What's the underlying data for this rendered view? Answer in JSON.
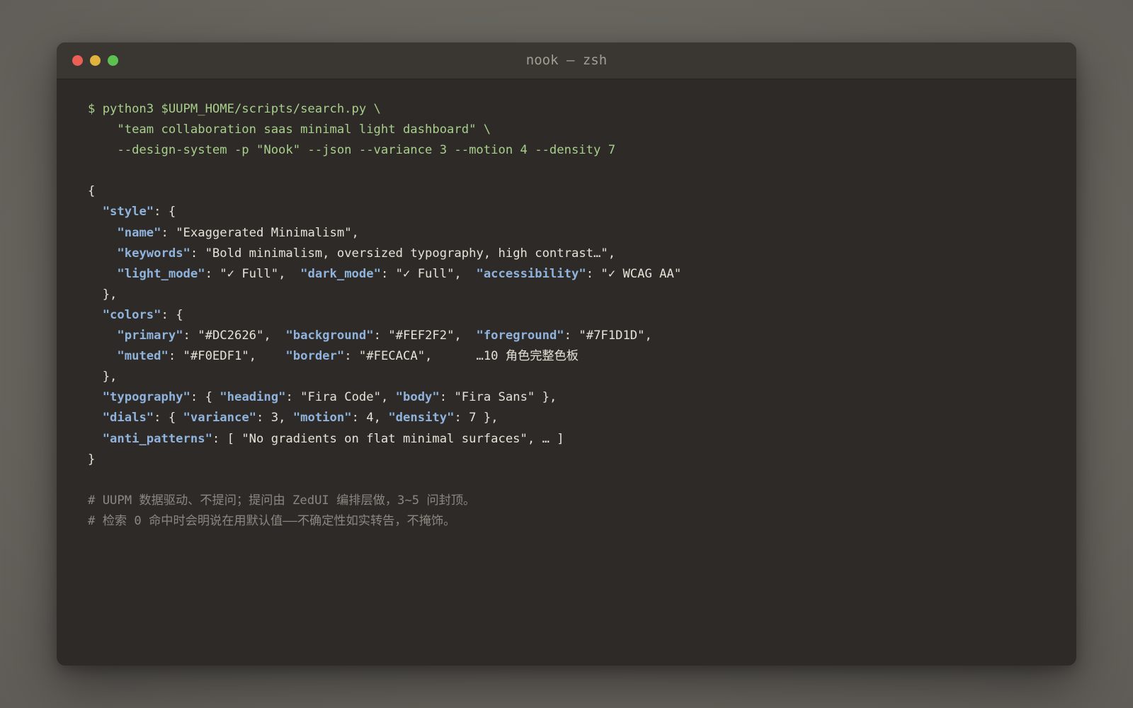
{
  "window": {
    "title": "nook — zsh",
    "accent_colors": {
      "close": "#ec5f57",
      "minimize": "#e0b23e",
      "zoom": "#5cc150",
      "command": "#a8cf8b",
      "json_key": "#8fb3dc",
      "comment": "#8c8780"
    }
  },
  "terminal": {
    "command": {
      "line1": "$ python3 $UUPM_HOME/scripts/search.py \\",
      "line2": "    \"team collaboration saas minimal light dashboard\" \\",
      "line3": "    --design-system -p \"Nook\" --json --variance 3 --motion 4 --density 7"
    },
    "json": {
      "open_brace": "{",
      "close_brace": "}",
      "style": {
        "open": "  ",
        "key": "\"style\"",
        "after": ": {",
        "name": {
          "indent": "    ",
          "key": "\"name\"",
          "rest": ": \"Exaggerated Minimalism\","
        },
        "keywords": {
          "indent": "    ",
          "key": "\"keywords\"",
          "rest": ": \"Bold minimalism, oversized typography, high contrast…\","
        },
        "modes": {
          "indent": "    ",
          "light_key": "\"light_mode\"",
          "light_val": ": \"✓ Full\",  ",
          "dark_key": "\"dark_mode\"",
          "dark_val": ": \"✓ Full\",  ",
          "access_key": "\"accessibility\"",
          "access_val": ": \"✓ WCAG AA\""
        },
        "close": "  },"
      },
      "colors": {
        "open": "  ",
        "key": "\"colors\"",
        "after": ": {",
        "row1": {
          "indent": "    ",
          "primary_key": "\"primary\"",
          "primary_val": ": \"#DC2626\",  ",
          "background_key": "\"background\"",
          "background_val": ": \"#FEF2F2\",  ",
          "foreground_key": "\"foreground\"",
          "foreground_val": ": \"#7F1D1D\","
        },
        "row2": {
          "indent": "    ",
          "muted_key": "\"muted\"",
          "muted_val": ": \"#F0EDF1\",    ",
          "border_key": "\"border\"",
          "border_val": ": \"#FECACA\",      …10 角色完整色板"
        },
        "close": "  },"
      },
      "typography": {
        "indent": "  ",
        "key": "\"typography\"",
        "mid1": ": { ",
        "heading_key": "\"heading\"",
        "heading_val": ": \"Fira Code\", ",
        "body_key": "\"body\"",
        "body_val": ": \"Fira Sans\" },"
      },
      "dials": {
        "indent": "  ",
        "key": "\"dials\"",
        "mid1": ": { ",
        "variance_key": "\"variance\"",
        "variance_val": ": 3, ",
        "motion_key": "\"motion\"",
        "motion_val": ": 4, ",
        "density_key": "\"density\"",
        "density_val": ": 7 },"
      },
      "anti_patterns": {
        "indent": "  ",
        "key": "\"anti_patterns\"",
        "rest": ": [ \"No gradients on flat minimal surfaces\", … ]"
      }
    },
    "comments": {
      "line1": "# UUPM 数据驱动、不提问；提问由 ZedUI 编排层做，3~5 问封顶。",
      "line2": "# 检索 0 命中时会明说在用默认值——不确定性如实转告，不掩饰。"
    }
  }
}
